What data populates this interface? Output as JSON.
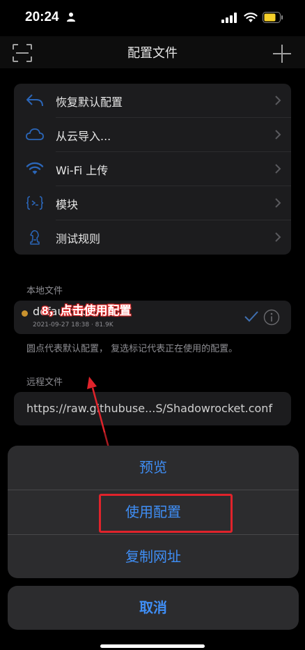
{
  "status_bar": {
    "time": "20:24"
  },
  "nav": {
    "title": "配置文件"
  },
  "menu": [
    {
      "label": "恢复默认配置",
      "icon": "undo-icon"
    },
    {
      "label": "从云导入...",
      "icon": "cloud-icon"
    },
    {
      "label": "Wi-Fi 上传",
      "icon": "wifi-icon"
    },
    {
      "label": "模块",
      "icon": "module-icon"
    },
    {
      "label": "测试规则",
      "icon": "chess-knight-icon"
    }
  ],
  "local": {
    "section_label": "本地文件",
    "file_name": "default.conf",
    "file_meta": "2021-09-27 18:38 · 81.9K",
    "note": "圆点代表默认配置， 复选标记代表正在使用的配置。"
  },
  "remote": {
    "section_label": "远程文件",
    "url": "https://raw.githubuse...S/Shadowrocket.conf"
  },
  "annotation": {
    "text": "8，点击使用配置"
  },
  "action_sheet": {
    "preview_label": "预览",
    "use_config_label": "使用配置",
    "copy_url_label": "复制网址",
    "cancel_label": "取消"
  },
  "colors": {
    "accent": "#3f8ef5",
    "annotation_red": "#e0232b",
    "default_dot": "#c9922e"
  }
}
